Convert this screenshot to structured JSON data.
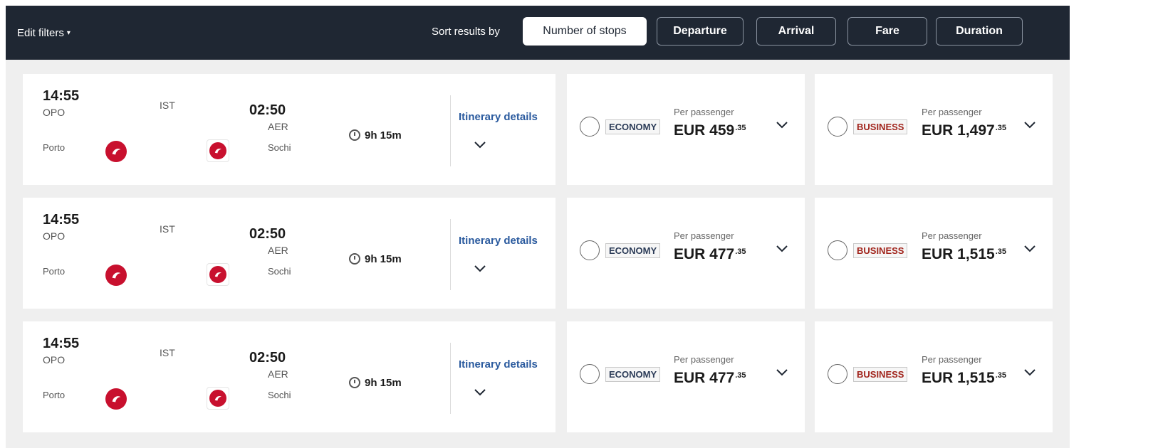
{
  "toolbar": {
    "edit_filters": "Edit filters",
    "sort_label": "Sort results by",
    "sort_buttons": [
      "Number of stops",
      "Departure",
      "Arrival",
      "Fare",
      "Duration"
    ]
  },
  "flights": [
    {
      "depart_time": "14:55",
      "depart_code": "OPO",
      "depart_city": "Porto",
      "via": "IST",
      "arrive_time": "02:50",
      "arrive_code": "AER",
      "arrive_city": "Sochi",
      "duration": "9h 15m",
      "itinerary_label": "Itinerary details",
      "economy": {
        "label": "ECONOMY",
        "per_passenger": "Per passenger",
        "price": "EUR 459",
        "cents": ".35"
      },
      "business": {
        "label": "BUSINESS",
        "per_passenger": "Per passenger",
        "price": "EUR 1,497",
        "cents": ".35"
      }
    },
    {
      "depart_time": "14:55",
      "depart_code": "OPO",
      "depart_city": "Porto",
      "via": "IST",
      "arrive_time": "02:50",
      "arrive_code": "AER",
      "arrive_city": "Sochi",
      "duration": "9h 15m",
      "itinerary_label": "Itinerary details",
      "economy": {
        "label": "ECONOMY",
        "per_passenger": "Per passenger",
        "price": "EUR 477",
        "cents": ".35"
      },
      "business": {
        "label": "BUSINESS",
        "per_passenger": "Per passenger",
        "price": "EUR 1,515",
        "cents": ".35"
      }
    },
    {
      "depart_time": "14:55",
      "depart_code": "OPO",
      "depart_city": "Porto",
      "via": "IST",
      "arrive_time": "02:50",
      "arrive_code": "AER",
      "arrive_city": "Sochi",
      "duration": "9h 15m",
      "itinerary_label": "Itinerary details",
      "economy": {
        "label": "ECONOMY",
        "per_passenger": "Per passenger",
        "price": "EUR 477",
        "cents": ".35"
      },
      "business": {
        "label": "BUSINESS",
        "per_passenger": "Per passenger",
        "price": "EUR 1,515",
        "cents": ".35"
      }
    }
  ],
  "icons": {
    "airline_logo": "turkish-airlines-logo",
    "chevron": "chevron-down-icon",
    "clock": "clock-icon"
  },
  "colors": {
    "topbar": "#1f2733",
    "airline_red": "#c8102e",
    "business": "#a1241c",
    "economy": "#2b3b57"
  }
}
